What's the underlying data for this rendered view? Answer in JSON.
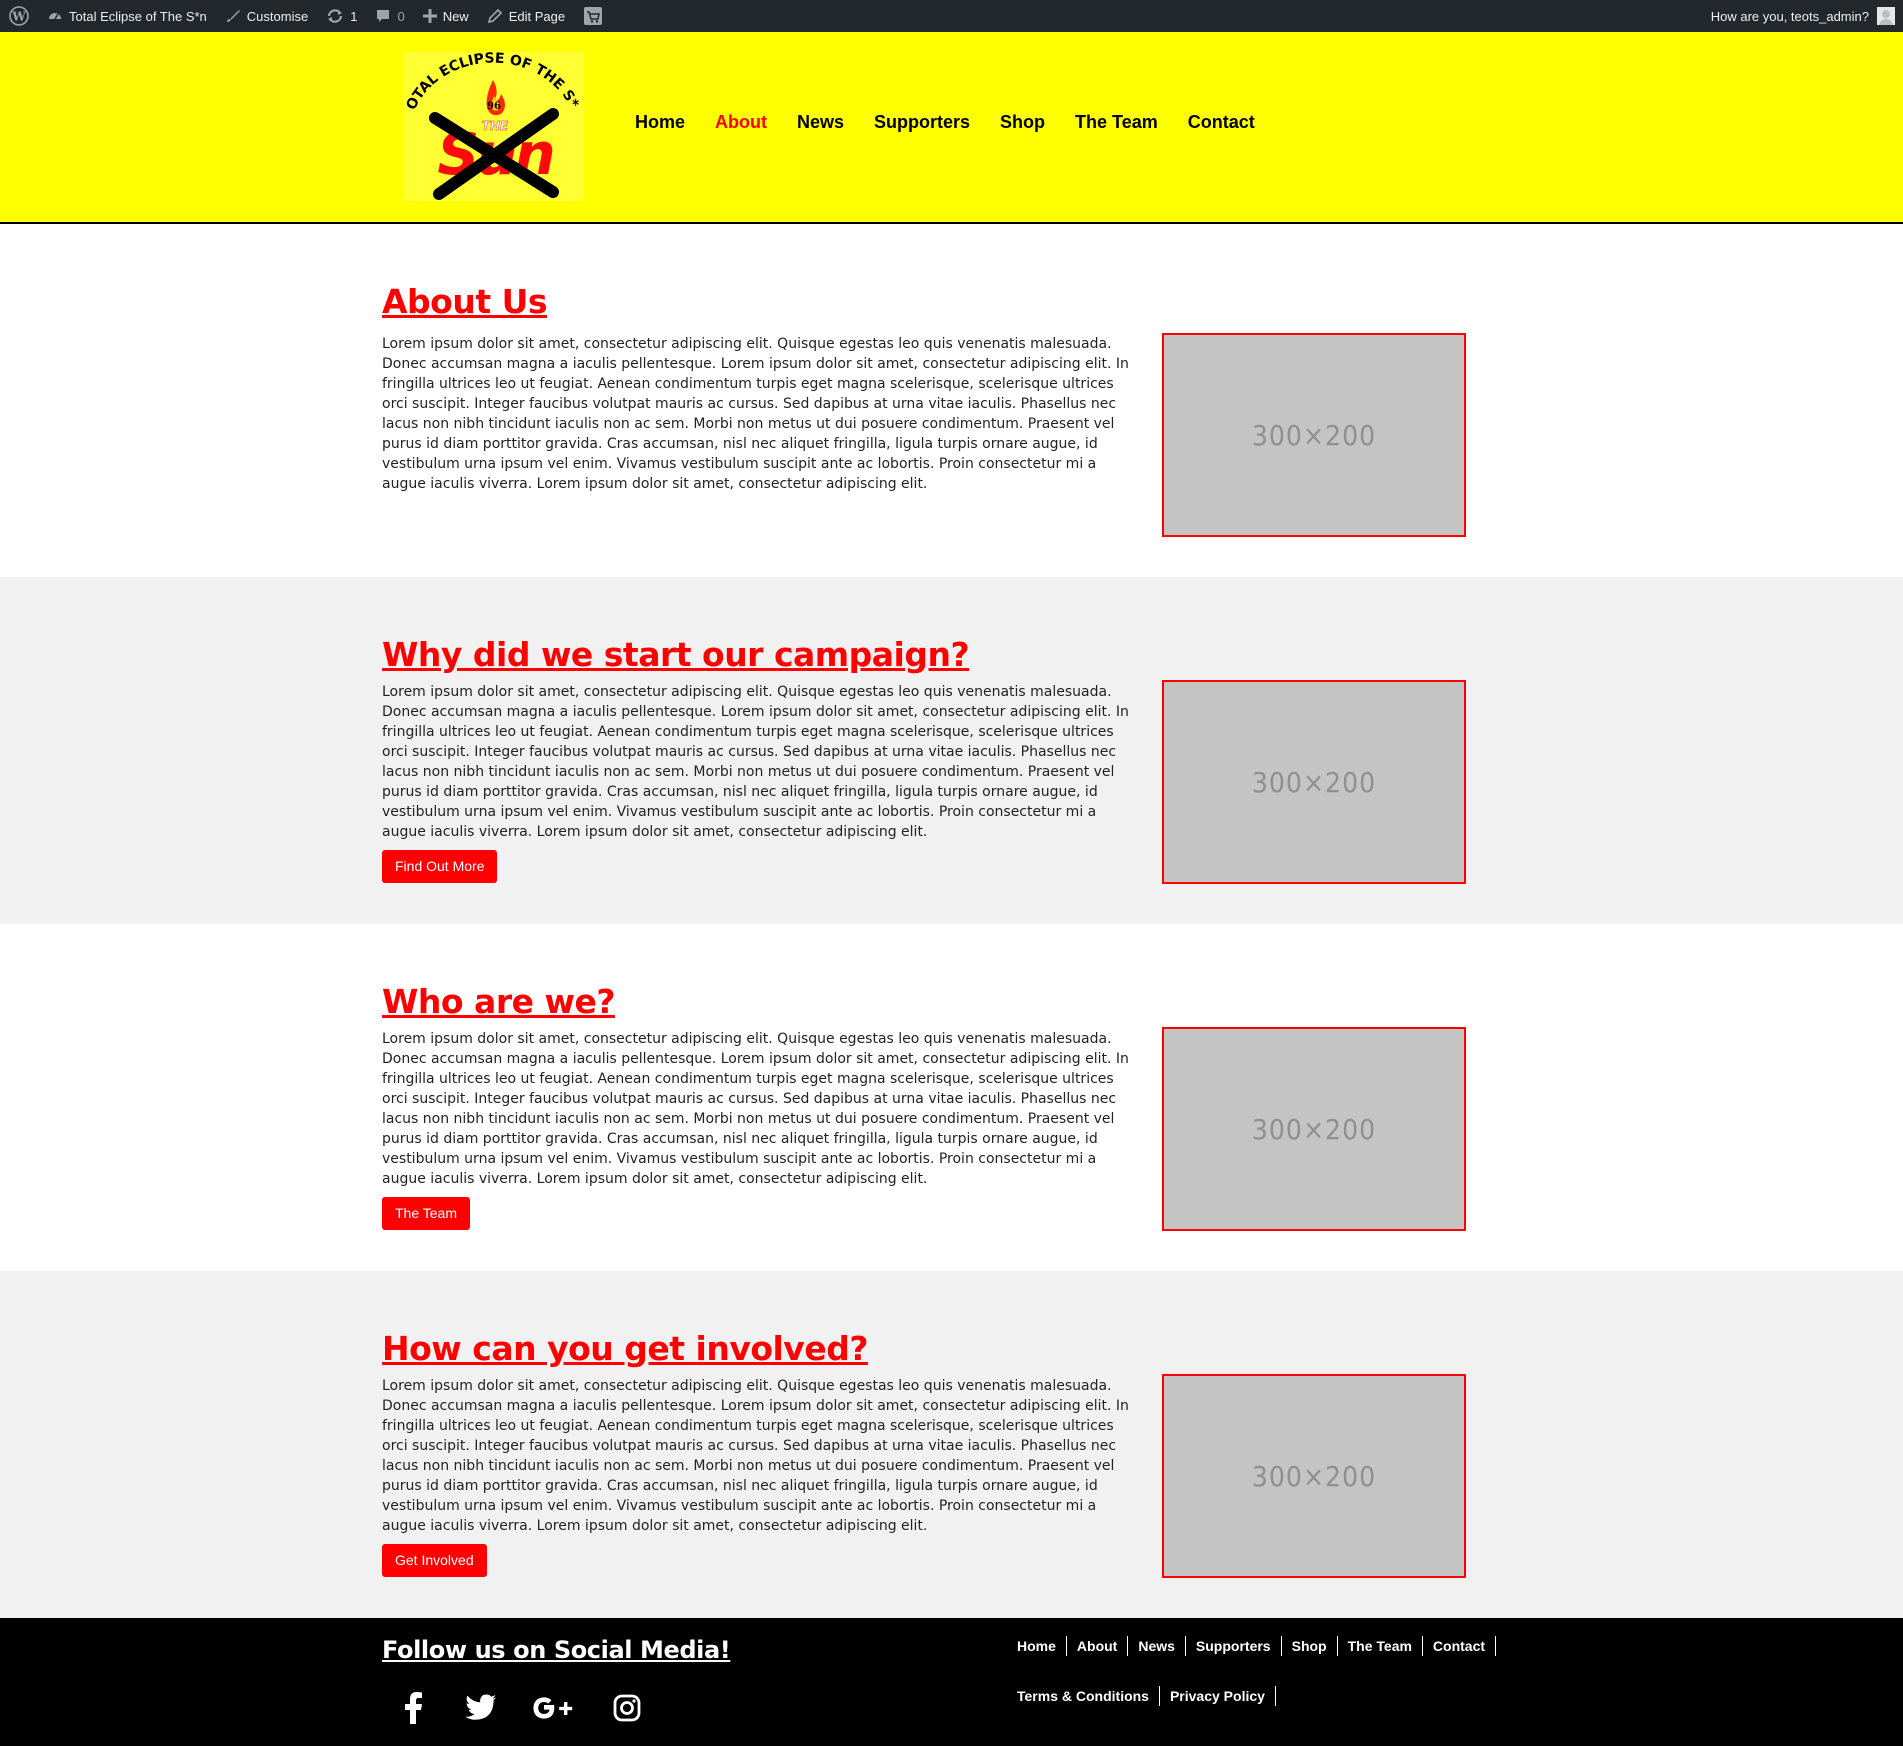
{
  "adminbar": {
    "site_name": "Total Eclipse of The S*n",
    "customise": "Customise",
    "updates_count": "1",
    "comments_count": "0",
    "new": "New",
    "edit_page": "Edit Page",
    "greeting": "How are you, teots_admin?"
  },
  "logo": {
    "alt": "Total Eclipse of The S*n logo",
    "arc_text": "TOTAL ECLIPSE OF THE S*N",
    "badge_number": "96",
    "the_text": "THE",
    "sun_text": "Sun"
  },
  "nav": {
    "items": [
      "Home",
      "About",
      "News",
      "Supporters",
      "Shop",
      "The Team",
      "Contact"
    ],
    "active": "About"
  },
  "lorem": "Lorem ipsum dolor sit amet, consectetur adipiscing elit. Quisque egestas leo quis venenatis malesuada. Donec accumsan magna a iaculis pellentesque. Lorem ipsum dolor sit amet, consectetur adipiscing elit. In fringilla ultrices leo ut feugiat. Aenean condimentum turpis eget magna scelerisque, scelerisque ultrices orci suscipit. Integer faucibus volutpat mauris ac cursus. Sed dapibus at urna vitae iaculis. Phasellus nec lacus non nibh tincidunt iaculis non ac sem. Morbi non metus ut dui posuere condimentum. Praesent vel purus id diam porttitor gravida. Cras accumsan, nisl nec aliquet fringilla, ligula turpis ornare augue, id vestibulum urna ipsum vel enim. Vivamus vestibulum suscipit ante ac lobortis. Proin consectetur mi a augue iaculis viverra. Lorem ipsum dolor sit amet, consectetur adipiscing elit.",
  "sections": [
    {
      "title": "About Us",
      "text": "Lorem ipsum dolor sit amet, consectetur adipiscing elit. Quisque egestas leo quis venenatis malesuada. Donec accumsan magna a iaculis pellentesque. Lorem ipsum dolor sit amet, consectetur adipiscing elit. In fringilla ultrices leo ut feugiat. Aenean condimentum turpis eget magna scelerisque, scelerisque ultrices orci suscipit. Integer faucibus volutpat mauris ac cursus. Sed dapibus at urna vitae iaculis. Phasellus nec lacus non nibh tincidunt iaculis non ac sem. Morbi non metus ut dui posuere condimentum. Praesent vel purus id diam porttitor gravida. Cras accumsan, nisl nec aliquet fringilla, ligula turpis ornare augue, id vestibulum urna ipsum vel enim. Vivamus vestibulum suscipit ante ac lobortis. Proin consectetur mi a augue iaculis viverra. Lorem ipsum dolor sit amet, consectetur adipiscing elit.",
      "button": "",
      "image_label": "300×200"
    },
    {
      "title": "Why did we start our campaign?",
      "text": "Lorem ipsum dolor sit amet, consectetur adipiscing elit. Quisque egestas leo quis venenatis malesuada. Donec accumsan magna a iaculis pellentesque. Lorem ipsum dolor sit amet, consectetur adipiscing elit. In fringilla ultrices leo ut feugiat. Aenean condimentum turpis eget magna scelerisque, scelerisque ultrices orci suscipit. Integer faucibus volutpat mauris ac cursus. Sed dapibus at urna vitae iaculis. Phasellus nec lacus non nibh tincidunt iaculis non ac sem. Morbi non metus ut dui posuere condimentum. Praesent vel purus id diam porttitor gravida. Cras accumsan, nisl nec aliquet fringilla, ligula turpis ornare augue, id vestibulum urna ipsum vel enim. Vivamus vestibulum suscipit ante ac lobortis. Proin consectetur mi a augue iaculis viverra. Lorem ipsum dolor sit amet, consectetur adipiscing elit.",
      "button": "Find Out More",
      "image_label": "300×200"
    },
    {
      "title": "Who are we?",
      "text": "Lorem ipsum dolor sit amet, consectetur adipiscing elit. Quisque egestas leo quis venenatis malesuada. Donec accumsan magna a iaculis pellentesque. Lorem ipsum dolor sit amet, consectetur adipiscing elit. In fringilla ultrices leo ut feugiat. Aenean condimentum turpis eget magna scelerisque, scelerisque ultrices orci suscipit. Integer faucibus volutpat mauris ac cursus. Sed dapibus at urna vitae iaculis. Phasellus nec lacus non nibh tincidunt iaculis non ac sem. Morbi non metus ut dui posuere condimentum. Praesent vel purus id diam porttitor gravida. Cras accumsan, nisl nec aliquet fringilla, ligula turpis ornare augue, id vestibulum urna ipsum vel enim. Vivamus vestibulum suscipit ante ac lobortis. Proin consectetur mi a augue iaculis viverra. Lorem ipsum dolor sit amet, consectetur adipiscing elit.",
      "button": "The Team",
      "image_label": "300×200"
    },
    {
      "title": "How can you get involved?",
      "text": "Lorem ipsum dolor sit amet, consectetur adipiscing elit. Quisque egestas leo quis venenatis malesuada. Donec accumsan magna a iaculis pellentesque. Lorem ipsum dolor sit amet, consectetur adipiscing elit. In fringilla ultrices leo ut feugiat. Aenean condimentum turpis eget magna scelerisque, scelerisque ultrices orci suscipit. Integer faucibus volutpat mauris ac cursus. Sed dapibus at urna vitae iaculis. Phasellus nec lacus non nibh tincidunt iaculis non ac sem. Morbi non metus ut dui posuere condimentum. Praesent vel purus id diam porttitor gravida. Cras accumsan, nisl nec aliquet fringilla, ligula turpis ornare augue, id vestibulum urna ipsum vel enim. Vivamus vestibulum suscipit ante ac lobortis. Proin consectetur mi a augue iaculis viverra. Lorem ipsum dolor sit amet, consectetur adipiscing elit.",
      "button": "Get Involved",
      "image_label": "300×200"
    }
  ],
  "footer": {
    "follow_title": "Follow us on Social Media!",
    "social_icons": [
      "facebook-icon",
      "twitter-icon",
      "google-plus-icon",
      "instagram-icon"
    ],
    "nav_items": [
      "Home",
      "About",
      "News",
      "Supporters",
      "Shop",
      "The Team",
      "Contact"
    ],
    "legal_items": [
      "Terms & Conditions",
      "Privacy Policy"
    ]
  },
  "colors": {
    "accent": "#ff0000",
    "header_bg": "#ffff00",
    "adminbar_bg": "#23282d",
    "grey_section_bg": "#f1f1f1",
    "footer_bg": "#000000"
  }
}
